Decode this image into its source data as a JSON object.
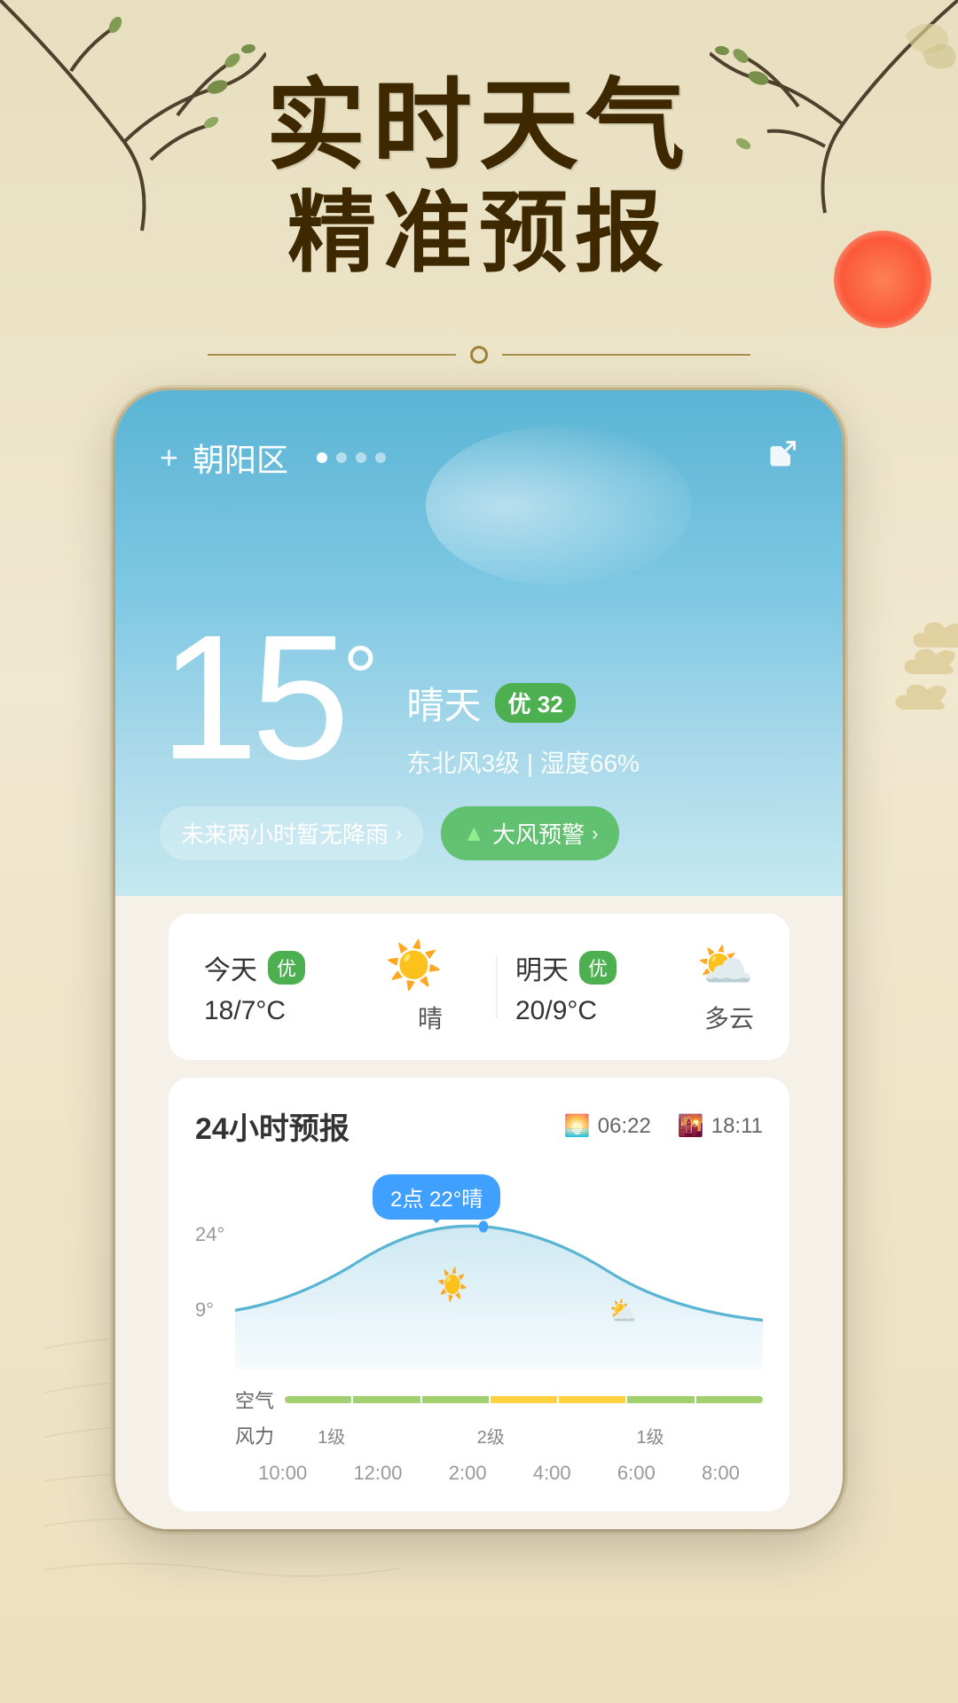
{
  "page": {
    "background_color": "#f0e8d0"
  },
  "hero": {
    "title_line1": "实时天气",
    "title_line2": "精准预报"
  },
  "app": {
    "location": "朝阳区",
    "add_label": "+",
    "temperature": "15",
    "degree_symbol": "°",
    "weather_type": "晴天",
    "aqi_label": "优",
    "aqi_value": "32",
    "wind_info": "东北风3级",
    "humidity": "湿度66%",
    "alert1": "未来两小时暂无降雨",
    "alert2": "大风预警",
    "today_label": "今天",
    "today_badge": "优",
    "today_temp": "18/7°C",
    "today_condition": "晴",
    "tomorrow_label": "明天",
    "tomorrow_badge": "优",
    "tomorrow_temp": "20/9°C",
    "tomorrow_condition": "多云",
    "forecast_title": "24小时预报",
    "sunrise_label": "06:22",
    "sunset_label": "18:11",
    "tooltip_text": "2点 22°晴",
    "chart_y_high": "24°",
    "chart_y_low": "9°",
    "air_label": "空气",
    "wind_label": "风力",
    "time_labels": [
      "10:00",
      "12:00",
      "2:00",
      "4:00",
      "6:00",
      "8:00"
    ],
    "wind_levels": [
      "1级",
      "",
      "2级",
      "",
      "1级",
      ""
    ],
    "dots": [
      true,
      false,
      false,
      false
    ]
  }
}
